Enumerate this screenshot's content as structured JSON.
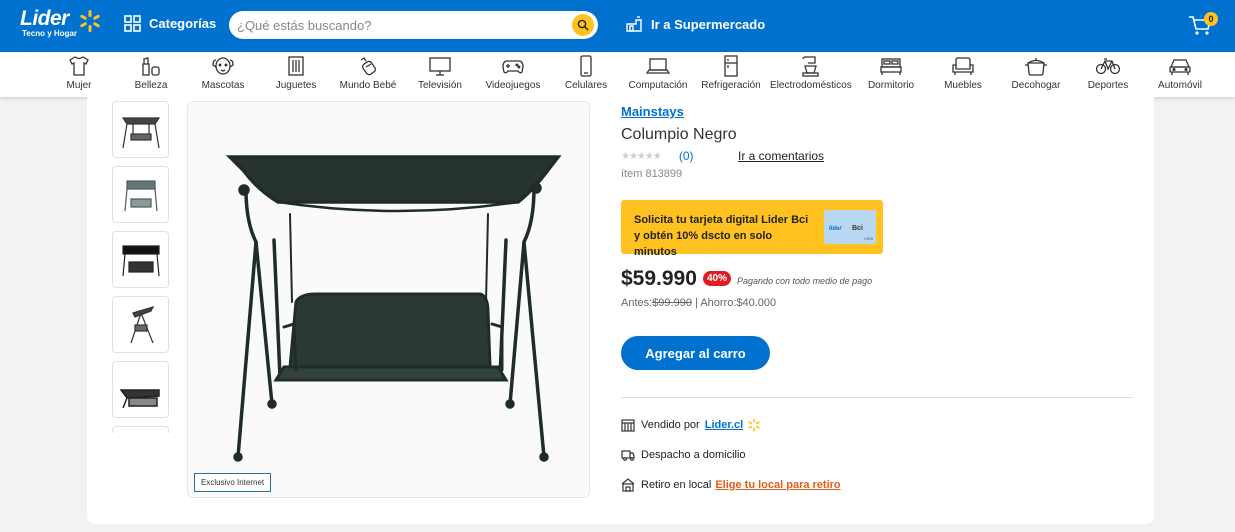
{
  "header": {
    "logo_text": "Lider",
    "logo_subtitle": "Tecno y Hogar",
    "categories_label": "Categorías",
    "search_placeholder": "¿Qué estás buscando?",
    "supermarket_label": "Ir a Supermercado",
    "cart_count": "0",
    "brand_color": "#0071ce",
    "accent_color": "#ffc220"
  },
  "category_bar": {
    "items": [
      {
        "label": "Mujer",
        "icon": "shirt-icon"
      },
      {
        "label": "Belleza",
        "icon": "cosmetics-icon"
      },
      {
        "label": "Mascotas",
        "icon": "dog-icon"
      },
      {
        "label": "Juguetes",
        "icon": "toy-icon"
      },
      {
        "label": "Mundo Bebé",
        "icon": "baby-bottle-icon"
      },
      {
        "label": "Televisión",
        "icon": "tv-icon"
      },
      {
        "label": "Videojuegos",
        "icon": "gamepad-icon"
      },
      {
        "label": "Celulares",
        "icon": "phone-icon"
      },
      {
        "label": "Computación",
        "icon": "laptop-icon"
      },
      {
        "label": "Refrigeración",
        "icon": "fridge-icon"
      },
      {
        "label": "Electrodomésticos",
        "icon": "mixer-icon"
      },
      {
        "label": "Dormitorio",
        "icon": "bed-icon"
      },
      {
        "label": "Muebles",
        "icon": "sofa-icon"
      },
      {
        "label": "Decohogar",
        "icon": "pot-icon"
      },
      {
        "label": "Deportes",
        "icon": "bicycle-icon"
      },
      {
        "label": "Automóvil",
        "icon": "car-icon"
      }
    ]
  },
  "gallery": {
    "thumbnail_count": 6,
    "badge": "Exclusivo Internet"
  },
  "product": {
    "brand": "Mainstays",
    "title": "Columpio Negro",
    "stars": "★★★★★",
    "rating_count": "(0)",
    "reviews_link": "Ir a comentarios",
    "item_number": "ítem 813899",
    "promo_text": "Solicita tu tarjeta digital Lider Bci y obtén 10% dscto en solo minutos",
    "promo_card_label": "lider Bci",
    "price": "$59.990",
    "discount": "40%",
    "payment_note": "Pagando con todo medio de pago",
    "before_label": "Antes:",
    "before_price": "$99.990",
    "savings": "| Ahorro:$40.000",
    "add_to_cart": "Agregar al carro",
    "sold_by_label": "Vendido por",
    "sold_by": "Lider.cl",
    "delivery": "Despacho a domicilio",
    "pickup_label": "Retiro en local",
    "pickup_link": "Elige tu local para retiro",
    "discount_color": "#de1c24",
    "pickup_link_color": "#e35c1c"
  }
}
